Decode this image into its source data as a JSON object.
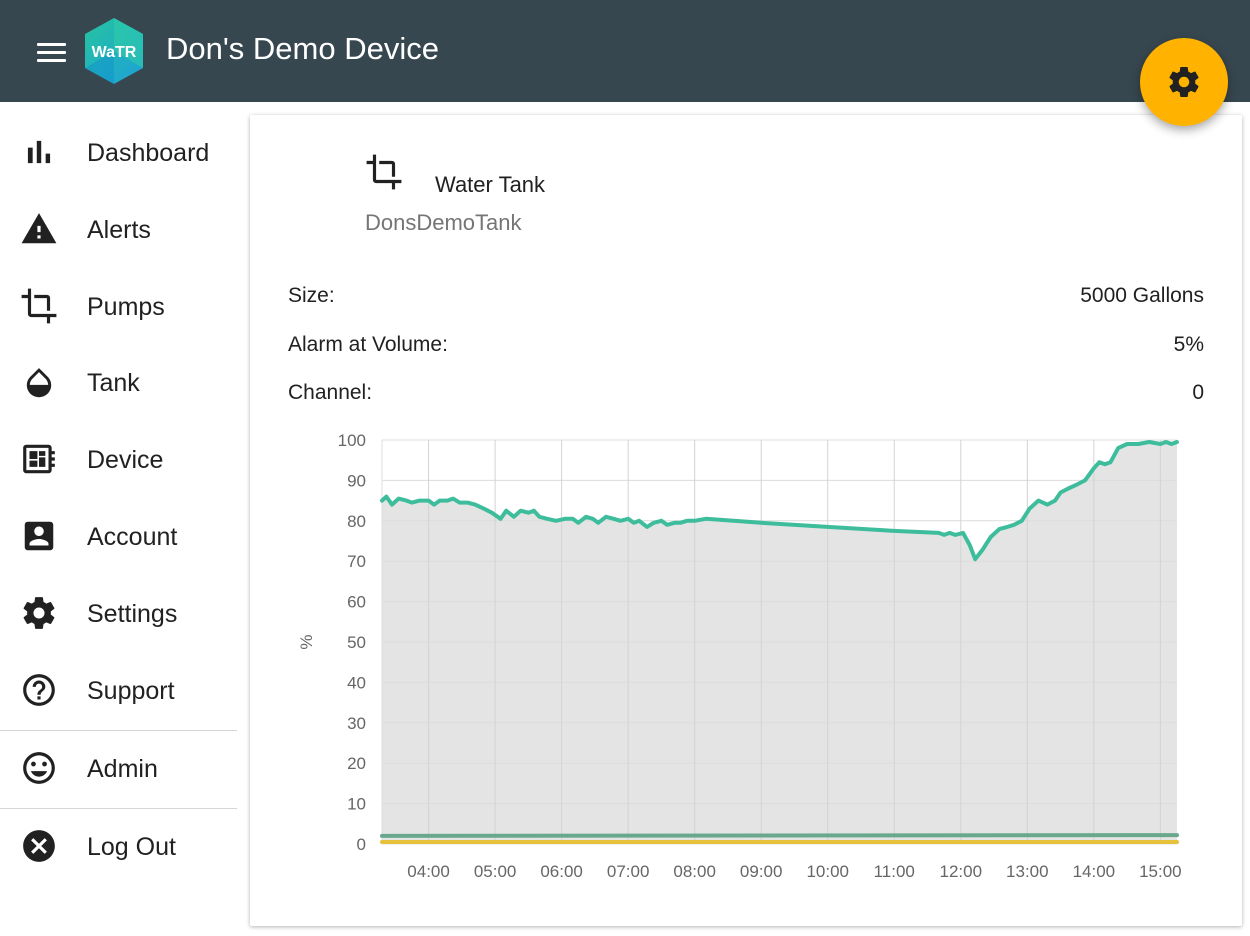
{
  "header": {
    "title": "Don's Demo Device",
    "logo_text": "WaTR",
    "menu_icon": "menu-icon",
    "fab_icon": "gear-icon",
    "bg_color": "#37474f",
    "fab_color": "#ffb300"
  },
  "sidebar": {
    "items": [
      {
        "label": "Dashboard",
        "icon": "bar-chart-icon"
      },
      {
        "label": "Alerts",
        "icon": "warning-icon"
      },
      {
        "label": "Pumps",
        "icon": "crop-icon"
      },
      {
        "label": "Tank",
        "icon": "water-drop-icon"
      },
      {
        "label": "Device",
        "icon": "device-icon"
      },
      {
        "label": "Account",
        "icon": "account-box-icon"
      },
      {
        "label": "Settings",
        "icon": "gear-icon"
      },
      {
        "label": "Support",
        "icon": "help-circle-icon"
      },
      {
        "label": "Admin",
        "icon": "smiley-icon"
      },
      {
        "label": "Log Out",
        "icon": "close-circle-icon"
      }
    ]
  },
  "card": {
    "title": "Water Tank",
    "subtitle": "DonsDemoTank",
    "icon": "crop-icon",
    "rows": [
      {
        "label": "Size:",
        "value": "5000 Gallons"
      },
      {
        "label": "Alarm at Volume:",
        "value": "5%"
      },
      {
        "label": "Channel:",
        "value": "0"
      }
    ]
  },
  "chart_data": {
    "type": "area",
    "xlabel": "",
    "ylabel": "%",
    "ylim": [
      0,
      100
    ],
    "yticks": [
      0,
      10,
      20,
      30,
      40,
      50,
      60,
      70,
      80,
      90,
      100
    ],
    "xlim": [
      "03:18",
      "15:15"
    ],
    "xtick_labels": [
      "04:00",
      "05:00",
      "06:00",
      "07:00",
      "08:00",
      "09:00",
      "10:00",
      "11:00",
      "12:00",
      "13:00",
      "14:00",
      "15:00"
    ],
    "grid": true,
    "series": [
      {
        "color": "#3dbd9b",
        "fill": "#e4e4e4",
        "points": [
          [
            "03:18",
            85
          ],
          [
            "03:22",
            86
          ],
          [
            "03:27",
            84
          ],
          [
            "03:33",
            85.5
          ],
          [
            "03:40",
            85
          ],
          [
            "03:45",
            84.5
          ],
          [
            "03:52",
            85
          ],
          [
            "04:00",
            85
          ],
          [
            "04:05",
            84
          ],
          [
            "04:10",
            85
          ],
          [
            "04:17",
            85
          ],
          [
            "04:22",
            85.5
          ],
          [
            "04:28",
            84.5
          ],
          [
            "04:35",
            84.5
          ],
          [
            "04:42",
            84
          ],
          [
            "04:50",
            83
          ],
          [
            "04:57",
            82
          ],
          [
            "05:05",
            80.5
          ],
          [
            "05:10",
            82.5
          ],
          [
            "05:17",
            81
          ],
          [
            "05:23",
            82.5
          ],
          [
            "05:30",
            82
          ],
          [
            "05:35",
            82.5
          ],
          [
            "05:40",
            81
          ],
          [
            "05:47",
            80.5
          ],
          [
            "05:55",
            80
          ],
          [
            "06:03",
            80.5
          ],
          [
            "06:10",
            80.5
          ],
          [
            "06:15",
            79.5
          ],
          [
            "06:22",
            81
          ],
          [
            "06:28",
            80.5
          ],
          [
            "06:33",
            79.5
          ],
          [
            "06:40",
            81
          ],
          [
            "06:47",
            80.5
          ],
          [
            "06:53",
            80
          ],
          [
            "07:00",
            80.5
          ],
          [
            "07:05",
            79.5
          ],
          [
            "07:10",
            80
          ],
          [
            "07:17",
            78.5
          ],
          [
            "07:23",
            79.5
          ],
          [
            "07:30",
            80
          ],
          [
            "07:35",
            79
          ],
          [
            "07:42",
            79.5
          ],
          [
            "07:47",
            79.5
          ],
          [
            "07:53",
            80
          ],
          [
            "08:00",
            80
          ],
          [
            "08:10",
            80.5
          ],
          [
            "09:00",
            79.5
          ],
          [
            "10:00",
            78.5
          ],
          [
            "11:00",
            77.5
          ],
          [
            "11:40",
            77
          ],
          [
            "11:45",
            76.5
          ],
          [
            "11:50",
            77
          ],
          [
            "11:55",
            76.5
          ],
          [
            "12:02",
            77
          ],
          [
            "12:08",
            74
          ],
          [
            "12:13",
            70.5
          ],
          [
            "12:20",
            73
          ],
          [
            "12:27",
            76
          ],
          [
            "12:35",
            78
          ],
          [
            "12:42",
            78.5
          ],
          [
            "12:48",
            79
          ],
          [
            "12:55",
            80
          ],
          [
            "13:02",
            83
          ],
          [
            "13:10",
            85
          ],
          [
            "13:18",
            84
          ],
          [
            "13:25",
            85
          ],
          [
            "13:30",
            87
          ],
          [
            "13:37",
            88
          ],
          [
            "13:45",
            89
          ],
          [
            "13:52",
            90
          ],
          [
            "14:00",
            93
          ],
          [
            "14:05",
            94.5
          ],
          [
            "14:10",
            94
          ],
          [
            "14:15",
            94.5
          ],
          [
            "14:22",
            98
          ],
          [
            "14:30",
            99
          ],
          [
            "14:40",
            99
          ],
          [
            "14:50",
            99.5
          ],
          [
            "15:00",
            99
          ],
          [
            "15:05",
            99.5
          ],
          [
            "15:10",
            99
          ],
          [
            "15:15",
            99.5
          ]
        ]
      },
      {
        "color": "#6aa88e",
        "points": [
          [
            "03:18",
            2
          ],
          [
            "15:15",
            2.2
          ]
        ]
      },
      {
        "color": "#e6c23a",
        "points": [
          [
            "03:18",
            0.5
          ],
          [
            "15:15",
            0.5
          ]
        ]
      }
    ]
  }
}
